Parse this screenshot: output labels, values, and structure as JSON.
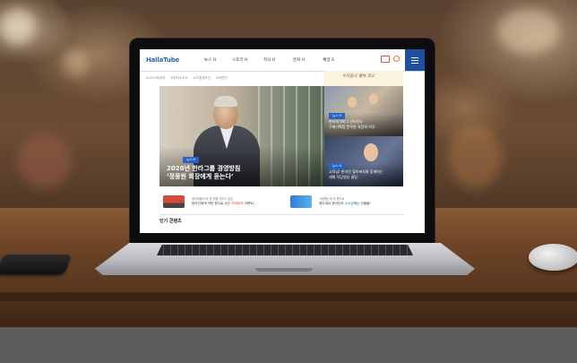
{
  "site": {
    "logo": "HallaTube",
    "logo_tag": "",
    "nav": [
      "뉴스 H",
      "스토리 H",
      "지식 H",
      "문화 H",
      "채널 S"
    ],
    "tags": [
      "#2020유성부",
      "#한라주의소",
      "#오일앤마인",
      "#바른인"
    ],
    "hero": {
      "badge": "뉴스 H",
      "title_line1": "2020년 한라그룹 경영방침",
      "title_line2": "‘정몽원 회장에게 듣는다’"
    },
    "side_banner": "우리들의 행복 학교",
    "cards": [
      {
        "badge": "뉴스 H",
        "title_line1": "한라의 V로그 (주)만도",
        "title_line2": "구매기획팀 윤주현 차장의 하루"
      },
      {
        "badge": "뉴스 H",
        "title_line1": "고모님! 한라인 할아버지와 함께하는",
        "title_line2": "새해 덕담영상 꿀팁"
      }
    ],
    "promos": [
      {
        "line1": "한라피플이 꼭 한 번쯤 이야기 같은",
        "line2_pre": "한라인에게 따뜻 힘으로 주는 ",
        "line2_hl": "커피트럭",
        "line2_post": " 이벤트!"
      },
      {
        "line1": "시청했는데 안 봤어요",
        "line2_pre": "해주세요 한라인의 ",
        "line2_hl": "수요일",
        "line2_post": "에는 선물을!"
      }
    ],
    "section_title": "인기 콘텐츠"
  },
  "colors": {
    "brand_blue": "#2a66b8",
    "menu_blue": "#1e4fa0",
    "badge_blue": "#2563c4",
    "promo_red": "#d83b2b"
  },
  "icons": [
    "mail-icon",
    "search-icon",
    "hamburger-menu-icon"
  ]
}
